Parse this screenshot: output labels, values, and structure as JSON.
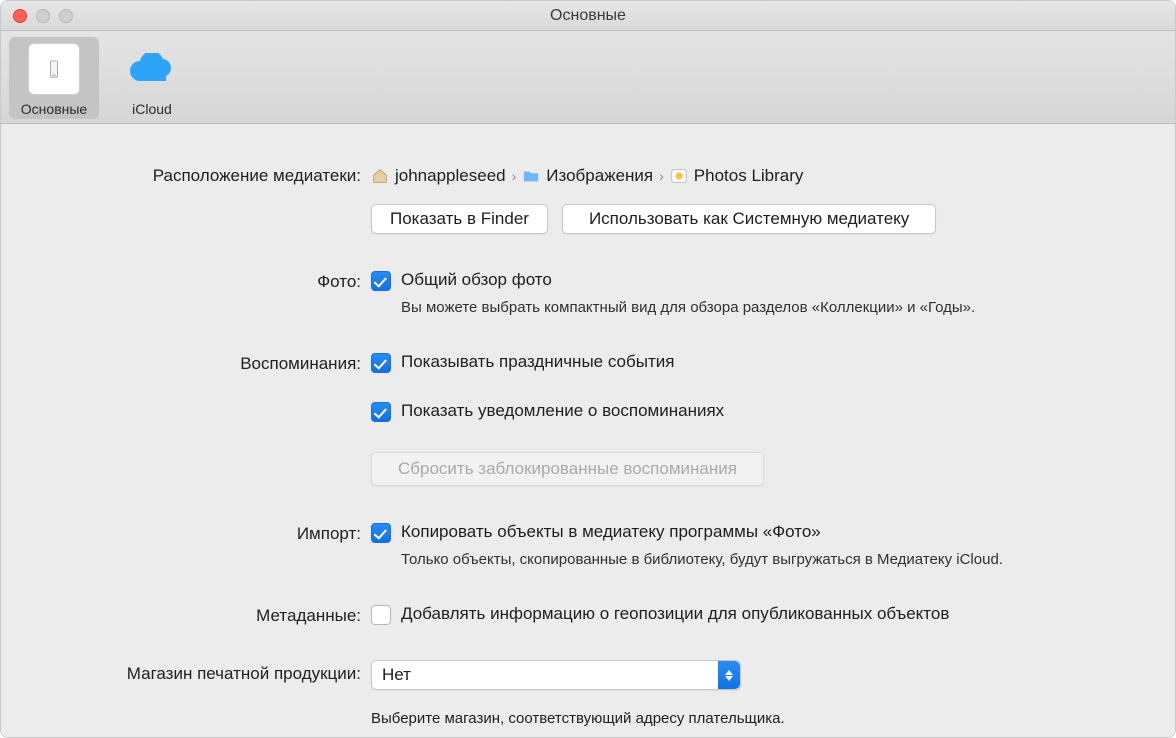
{
  "window": {
    "title": "Основные"
  },
  "tabs": {
    "general": "Основные",
    "icloud": "iCloud"
  },
  "library": {
    "label": "Расположение медиатеки:",
    "path": [
      "johnappleseed",
      "Изображения",
      "Photos Library"
    ],
    "show_in_finder": "Показать в Finder",
    "use_as_system": "Использовать как Системную медиатеку"
  },
  "photos": {
    "label": "Фото:",
    "summary_checkbox": "Общий обзор фото",
    "summary_desc": "Вы можете выбрать компактный вид для обзора разделов «Коллекции» и «Годы»."
  },
  "memories": {
    "label": "Воспоминания:",
    "holiday_checkbox": "Показывать праздничные события",
    "notif_checkbox": "Показать уведомление о воспоминаниях",
    "reset_button": "Сбросить заблокированные воспоминания"
  },
  "import": {
    "label": "Импорт:",
    "copy_checkbox": "Копировать объекты в медиатеку программы «Фото»",
    "copy_desc": "Только объекты, скопированные в библиотеку, будут выгружаться в Медиатеку iCloud."
  },
  "metadata": {
    "label": "Метаданные:",
    "geo_checkbox": "Добавлять информацию о геопозиции для опубликованных объектов"
  },
  "store": {
    "label": "Магазин печатной продукции:",
    "value": "Нет",
    "desc": "Выберите магазин, соответствующий адресу плательщика."
  }
}
